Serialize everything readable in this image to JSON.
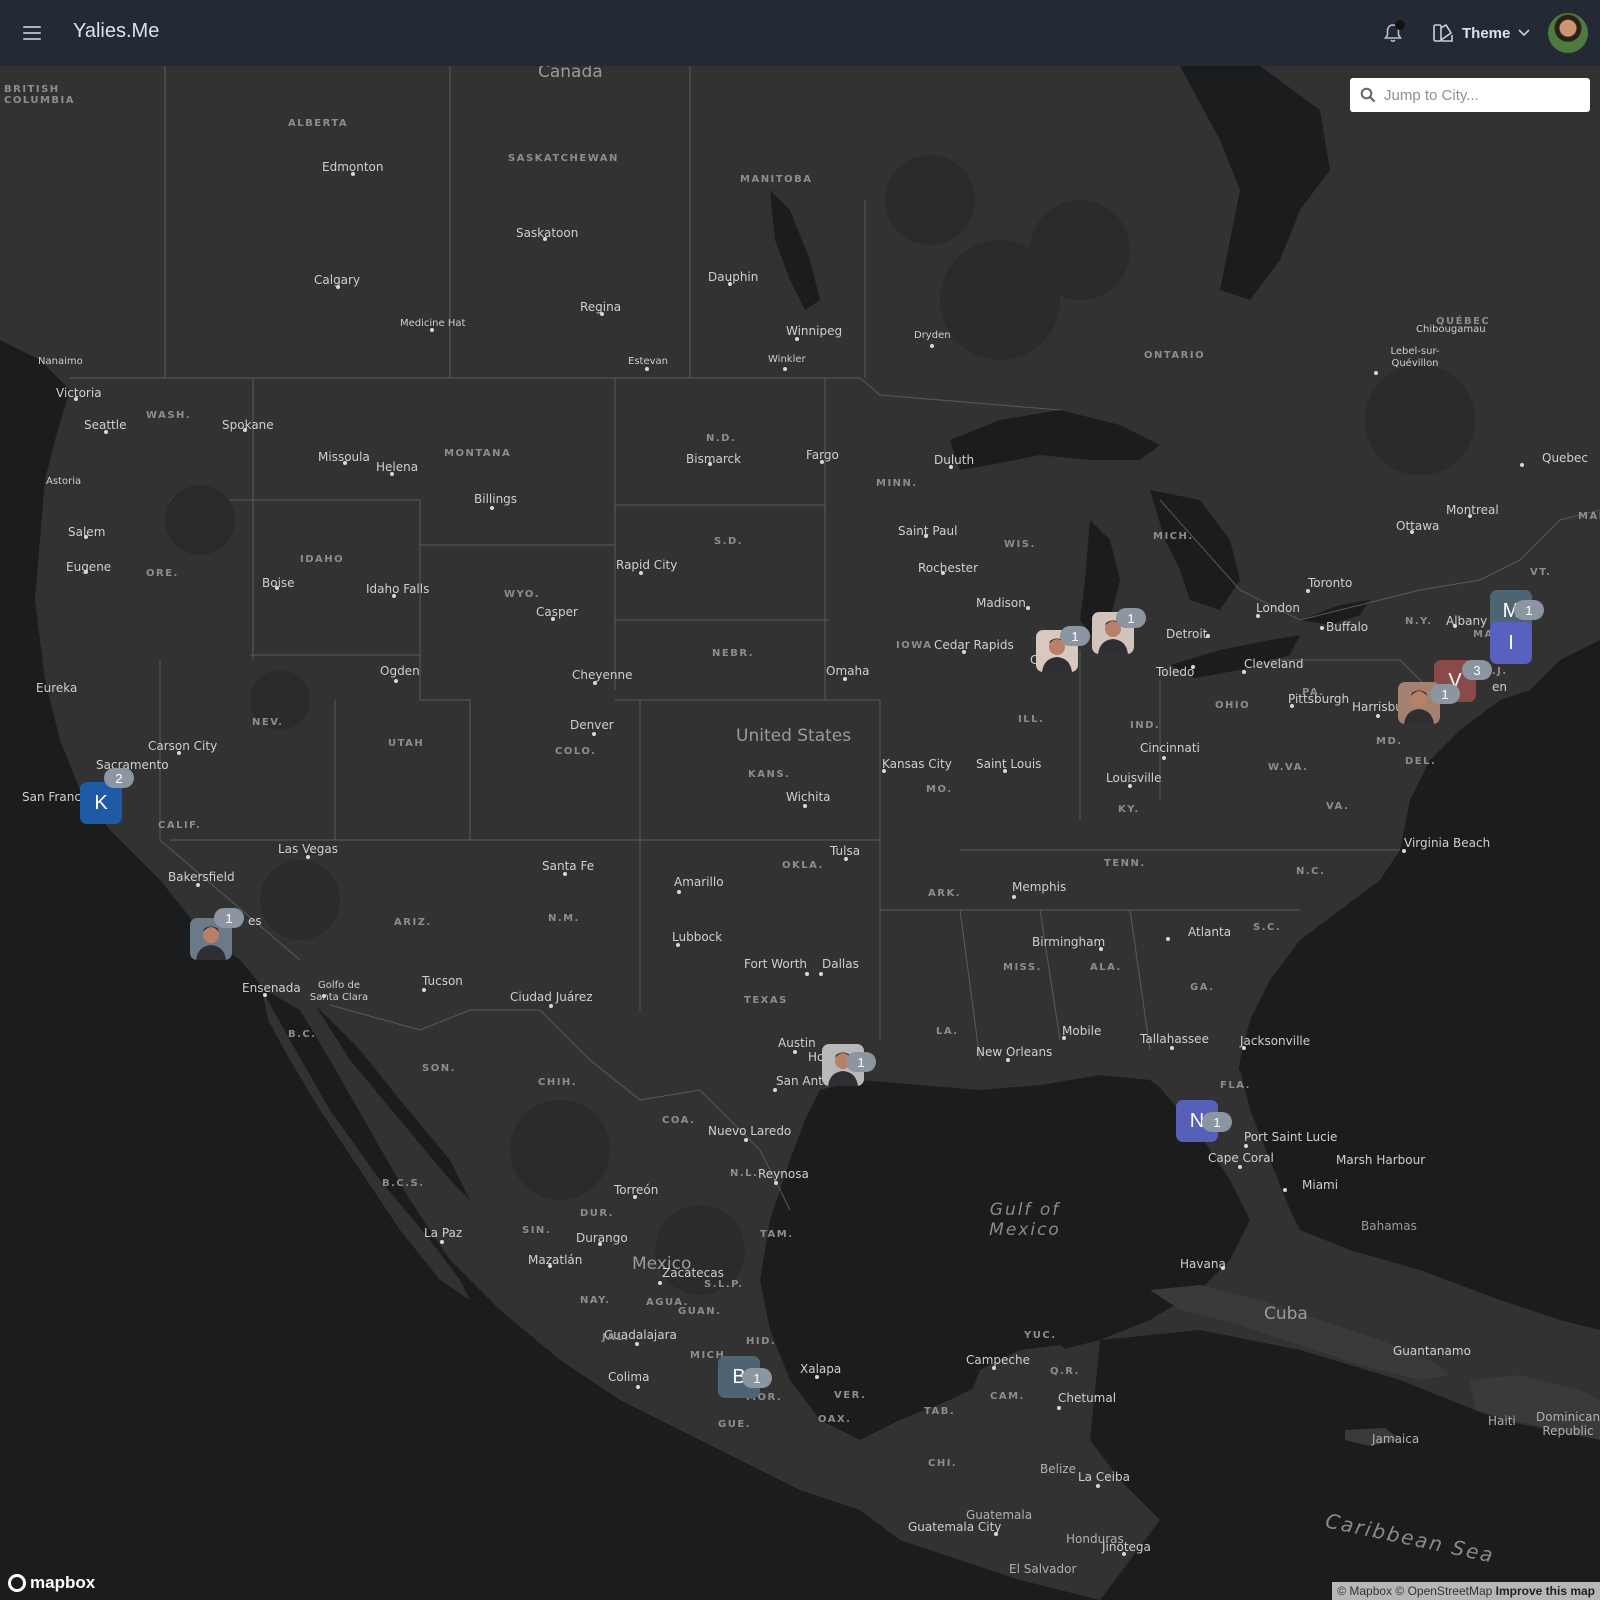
{
  "navbar": {
    "brand": "Yalies.Me",
    "theme_label": "Theme",
    "menu_icon": "hamburger-menu-icon",
    "bell_icon": "bell-icon",
    "theme_icon": "palette-icon"
  },
  "search": {
    "placeholder": "Jump to City..."
  },
  "map": {
    "countries": [
      "Canada",
      "United States",
      "Mexico",
      "Cuba",
      "Bahamas",
      "Guatemala",
      "Honduras",
      "El Salvador",
      "Belize",
      "Jamaica",
      "Haiti",
      "Dominican Republic"
    ],
    "water": [
      "Gulf of Mexico",
      "Caribbean Sea"
    ],
    "cities": [
      "Edmonton",
      "Saskatoon",
      "Calgary",
      "Regina",
      "Medicine Hat",
      "Estevan",
      "Winnipeg",
      "Winkler",
      "Dauphin",
      "Dryden",
      "Nanaimo",
      "Victoria",
      "Seattle",
      "Spokane",
      "Missoula",
      "Helena",
      "Astoria",
      "Salem",
      "Eugene",
      "Boise",
      "Idaho Falls",
      "Billings",
      "Bismarck",
      "Fargo",
      "Duluth",
      "Saint Paul",
      "Rochester",
      "Madison",
      "Detroit",
      "Toledo",
      "Cleveland",
      "Toronto",
      "Buffalo",
      "London",
      "Ottawa",
      "Montreal",
      "Quebec",
      "Chibougamau",
      "Lebel-sur-Quévillon",
      "Albany",
      "Pittsburgh",
      "Harrisburg",
      "Cincinnati",
      "Louisville",
      "Saint Louis",
      "Kansas City",
      "Omaha",
      "Cedar Rapids",
      "Rapid City",
      "Casper",
      "Cheyenne",
      "Ogden",
      "Denver",
      "Wichita",
      "Tulsa",
      "Eureka",
      "Carson City",
      "Sacramento",
      "San Franci",
      "Las Vegas",
      "Bakersfield",
      "Santa Fe",
      "Amarillo",
      "Lubbock",
      "Fort Worth",
      "Dallas",
      "Austin",
      "San Antonio",
      "Hous",
      "Memphis",
      "Birmingham",
      "Atlanta",
      "Virginia Beach",
      "Mobile",
      "New Orleans",
      "Tallahassee",
      "Jacksonville",
      "Port Saint Lucie",
      "Cape Coral",
      "Miami",
      "Marsh Harbour",
      "Havana",
      "Guantanamo",
      "Tucson",
      "Ensenada",
      "Golfo de Santa Clara",
      "Ciudad Juárez",
      "Nuevo Laredo",
      "Reynosa",
      "Torreón",
      "Durango",
      "Zacatecas",
      "Mazatlán",
      "La Paz",
      "Guadalajara",
      "Colima",
      "Xalapa",
      "Campeche",
      "Chetumal",
      "Guatemala City",
      "La Ceiba",
      "Jinotega"
    ],
    "city_partials": [
      "Chica",
      "es",
      "en"
    ],
    "states": [
      "BRITISH COLUMBIA",
      "ALBERTA",
      "SASKATCHEWAN",
      "MANITOBA",
      "ONTARIO",
      "QUÉBEC",
      "WASH.",
      "MONTANA",
      "N.D.",
      "MINN.",
      "S.D.",
      "WYO.",
      "IDAHO",
      "ORE.",
      "NEBR.",
      "IOWA",
      "WIS.",
      "MICH.",
      "NEV.",
      "UTAH",
      "COLO.",
      "KANS.",
      "MO.",
      "ILL.",
      "IND.",
      "OHIO",
      "PA.",
      "N.Y.",
      "VT.",
      "MAINE",
      "MASS.",
      "N.J.",
      "MD.",
      "DEL.",
      "W.VA.",
      "VA.",
      "KY.",
      "TENN.",
      "N.C.",
      "S.C.",
      "GA.",
      "ALA.",
      "MISS.",
      "LA.",
      "ARK.",
      "OKLA.",
      "TEXAS",
      "N.M.",
      "ARIZ.",
      "CALIF.",
      "B.C.",
      "SON.",
      "CHIH.",
      "COA.",
      "N.L.",
      "TAM.",
      "DUR.",
      "SIN.",
      "B.C.S.",
      "NAY.",
      "JAL.",
      "MICH.",
      "GUE.",
      "OAX.",
      "VER.",
      "TAB.",
      "CAM.",
      "YUC.",
      "Q.R.",
      "CHI.",
      "AGUA.",
      "S.L.P.",
      "GUAN.",
      "HID.",
      "MOR.",
      "FLA."
    ]
  },
  "markers": [
    {
      "label": "K",
      "count": "2",
      "color": "#1f5aa6"
    },
    {
      "label": "",
      "count": "1",
      "color": "#6b7a86"
    },
    {
      "label": "",
      "count": "1",
      "color": "#d8c8bd"
    },
    {
      "label": "",
      "count": "1",
      "color": "#d2c4bc"
    },
    {
      "label": "",
      "count": "1",
      "color": "#b9b9b9"
    },
    {
      "label": "N",
      "count": "1",
      "color": "#5660b8"
    },
    {
      "label": "B",
      "count": "1",
      "color": "#4f6472"
    },
    {
      "label": "M",
      "count": "1",
      "color": "#4f6472"
    },
    {
      "label": "I",
      "count": "",
      "color": "#5860c0"
    },
    {
      "label": "V",
      "count": "3",
      "color": "#8a4a4a"
    },
    {
      "label": "",
      "count": "1",
      "color": "#a48070"
    }
  ],
  "attribution": {
    "logo": "mapbox",
    "text": "© Mapbox © OpenStreetMap",
    "improve": "Improve this map"
  },
  "colors": {
    "navbar": "#232a36",
    "land": "#323232",
    "water": "#1b1c1d",
    "badge": "#8b96a2"
  }
}
